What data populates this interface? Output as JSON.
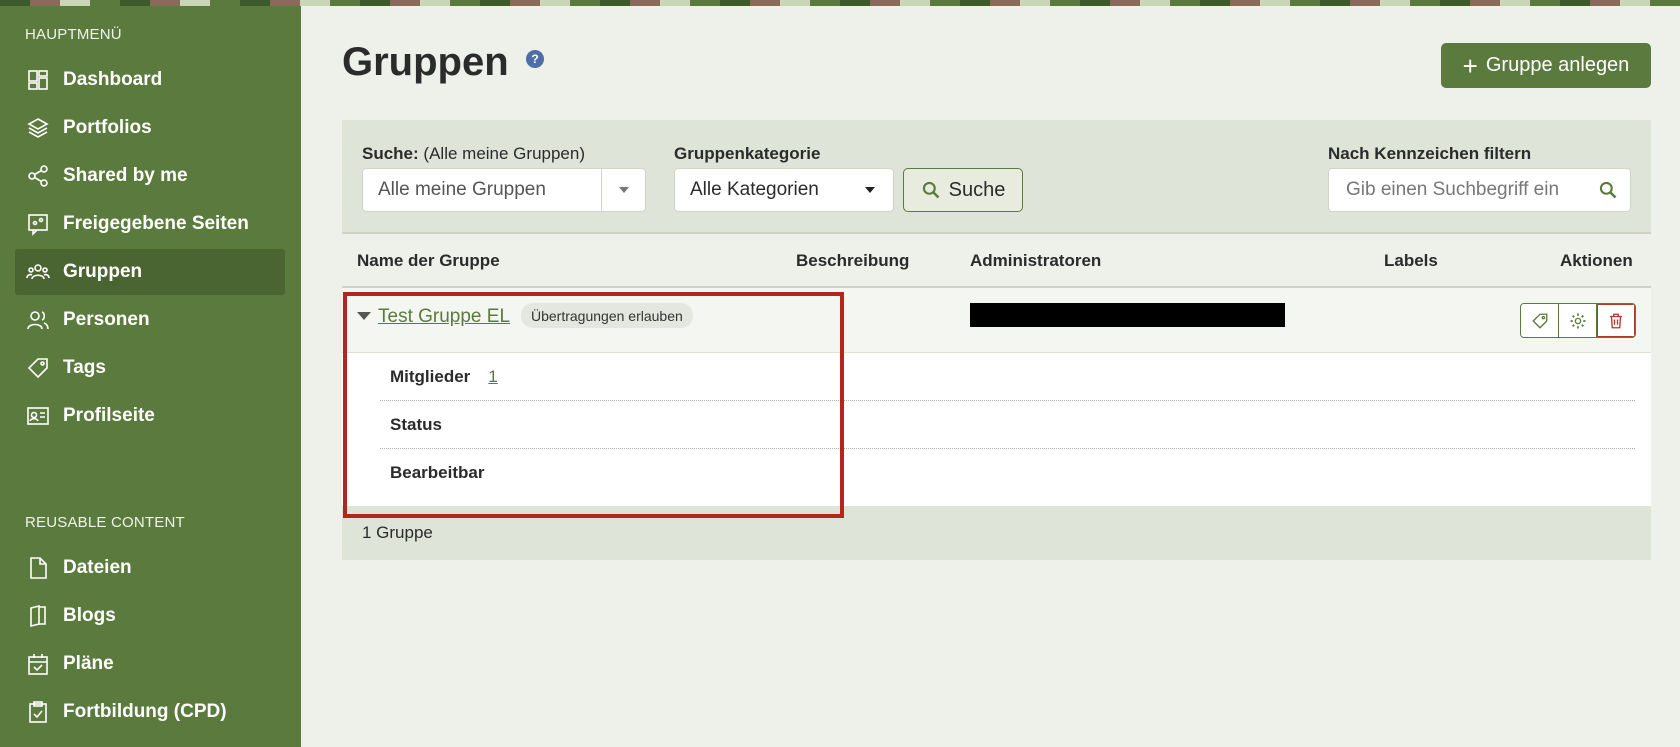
{
  "sidebar": {
    "main_heading": "HAUPTMENÜ",
    "items": [
      {
        "label": "Dashboard",
        "icon": "dashboard-icon"
      },
      {
        "label": "Portfolios",
        "icon": "layers-icon"
      },
      {
        "label": "Shared by me",
        "icon": "share-icon"
      },
      {
        "label": "Freigegebene Seiten",
        "icon": "shared-pages-icon"
      },
      {
        "label": "Gruppen",
        "icon": "group-icon",
        "active": true
      },
      {
        "label": "Personen",
        "icon": "people-icon"
      },
      {
        "label": "Tags",
        "icon": "tag-icon"
      },
      {
        "label": "Profilseite",
        "icon": "id-card-icon"
      }
    ],
    "reusable_heading": "REUSABLE CONTENT",
    "reusable_items": [
      {
        "label": "Dateien",
        "icon": "file-icon"
      },
      {
        "label": "Blogs",
        "icon": "book-icon"
      },
      {
        "label": "Pläne",
        "icon": "calendar-check-icon"
      },
      {
        "label": "Fortbildung (CPD)",
        "icon": "clipboard-check-icon"
      }
    ]
  },
  "header": {
    "title": "Gruppen",
    "help": "?",
    "new_group_label": "Gruppe anlegen"
  },
  "filters": {
    "search_label_bold": "Suche:",
    "search_label_rest": "(Alle meine Gruppen)",
    "search_value": "Alle meine Gruppen",
    "category_label": "Gruppenkategorie",
    "category_value": "Alle Kategorien",
    "search_button": "Suche",
    "tag_filter_label": "Nach Kennzeichen filtern",
    "tag_filter_placeholder": "Gib einen Suchbegriff ein"
  },
  "table": {
    "headers": [
      "Name der Gruppe",
      "Beschreibung",
      "Administratoren",
      "Labels",
      "Aktionen"
    ],
    "rows": [
      {
        "name": "Test Gruppe EL",
        "badge": "Übertragungen erlauben",
        "details": {
          "members_label": "Mitglieder",
          "members_count": "1",
          "status_label": "Status",
          "editable_label": "Bearbeitbar"
        }
      }
    ],
    "footer": "1 Gruppe"
  },
  "colors": {
    "brand": "#5b7a3e",
    "sidebar_active": "#4a6532",
    "delete": "#b03a2e",
    "highlight": "#b3261e"
  }
}
